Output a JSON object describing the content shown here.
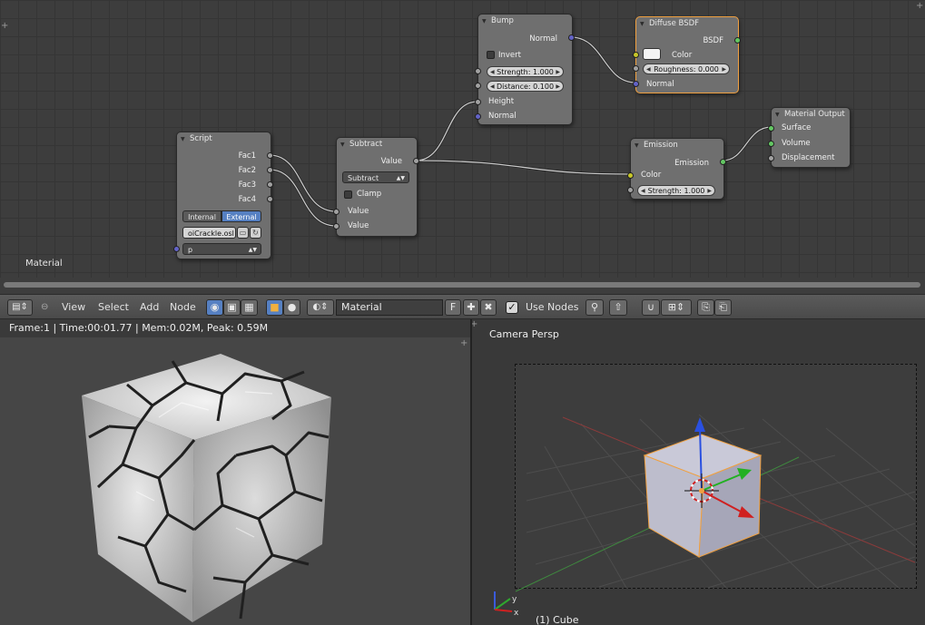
{
  "node_editor": {
    "label": "Material",
    "nodes": {
      "script": {
        "title": "Script",
        "outputs": [
          "Fac1",
          "Fac2",
          "Fac3",
          "Fac4"
        ],
        "mode_options": [
          "Internal",
          "External"
        ],
        "selected_mode": "External",
        "file": "oiCrackle.osl",
        "input_value": "p"
      },
      "subtract": {
        "title": "Subtract",
        "output": "Value",
        "operation": "Subtract",
        "clamp_label": "Clamp",
        "inputs": [
          "Value",
          "Value"
        ]
      },
      "bump": {
        "title": "Bump",
        "output": "Normal",
        "invert_label": "Invert",
        "strength": "Strength: 1.000",
        "distance": "Distance: 0.100",
        "inputs": [
          "Height",
          "Normal"
        ]
      },
      "diffuse": {
        "title": "Diffuse BSDF",
        "output": "BSDF",
        "color_label": "Color",
        "roughness": "Roughness: 0.000",
        "normal_label": "Normal"
      },
      "emission": {
        "title": "Emission",
        "output": "Emission",
        "color_label": "Color",
        "strength": "Strength: 1.000"
      },
      "material_output": {
        "title": "Material Output",
        "inputs": [
          "Surface",
          "Volume",
          "Displacement"
        ]
      }
    }
  },
  "header": {
    "menus": [
      "View",
      "Select",
      "Add",
      "Node"
    ],
    "material_name": "Material",
    "fake_user_label": "F",
    "use_nodes_label": "Use Nodes"
  },
  "render_view": {
    "info": "Frame:1 | Time:00:01.77 | Mem:0.02M, Peak: 0.59M"
  },
  "viewport": {
    "camera_label": "Camera Persp",
    "object_label": "(1) Cube",
    "axis_labels": [
      "y",
      "x"
    ]
  },
  "colors": {
    "socket_gray": "#a1a1a1",
    "socket_yellow": "#c7c729",
    "socket_blue": "#6363c7",
    "socket_green": "#63c763",
    "active_node_outline": "#f0a040",
    "selected_button": "#5680c2"
  }
}
